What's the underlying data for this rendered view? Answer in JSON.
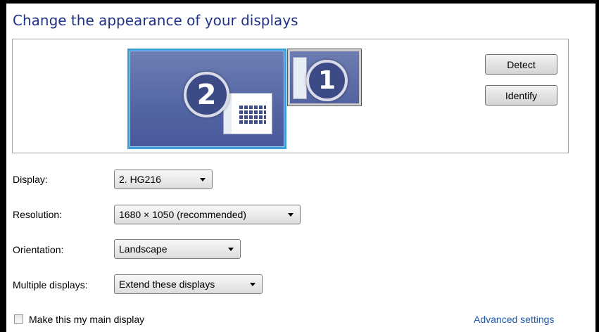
{
  "header": {
    "title": "Change the appearance of your displays"
  },
  "preview": {
    "monitors": [
      {
        "number": "2",
        "selected": true
      },
      {
        "number": "1",
        "selected": false
      }
    ],
    "detect_label": "Detect",
    "identify_label": "Identify"
  },
  "settings": {
    "display": {
      "label": "Display:",
      "value": "2. HG216"
    },
    "resolution": {
      "label": "Resolution:",
      "value": "1680 × 1050 (recommended)"
    },
    "orientation": {
      "label": "Orientation:",
      "value": "Landscape"
    },
    "multiple": {
      "label": "Multiple displays:",
      "value": "Extend these displays"
    }
  },
  "main_display": {
    "label": "Make this my main display",
    "checked": false
  },
  "advanced_link": "Advanced settings",
  "colors": {
    "accent": "#3e9ddb",
    "title": "#1e3287",
    "link": "#1e58a8"
  }
}
